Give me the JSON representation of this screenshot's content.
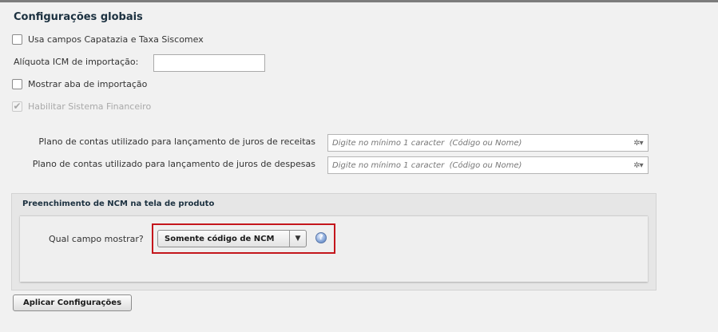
{
  "page": {
    "title": "Configurações globais"
  },
  "options": {
    "capatazia": {
      "label": "Usa campos Capatazia e Taxa Siscomex",
      "checked": false
    },
    "aliquota": {
      "label": "Alíquota ICM de importação:",
      "value": ""
    },
    "mostrar_aba": {
      "label": "Mostrar aba de importação",
      "checked": false
    },
    "financeiro": {
      "label": "Habilitar Sistema Financeiro",
      "checked": true,
      "disabled": true,
      "check_glyph": "✔"
    }
  },
  "plano_contas": {
    "receitas": {
      "label": "Plano de contas utilizado para lançamento de juros de receitas",
      "placeholder": "Digite no mínimo 1 caracter  (Código ou Nome)"
    },
    "despesas": {
      "label": "Plano de contas utilizado para lançamento de juros de despesas",
      "placeholder": "Digite no mínimo 1 caracter  (Código ou Nome)"
    },
    "gear_glyph": "✲▾"
  },
  "ncm_panel": {
    "title": "Preenchimento de NCM na tela de produto",
    "question_label": "Qual campo mostrar?",
    "selected_value": "Somente código de NCM",
    "arrow_glyph": "▼",
    "help_glyph": "?"
  },
  "actions": {
    "apply_label": "Aplicar Configurações"
  },
  "colors": {
    "highlight_border": "#c4161c",
    "title_color": "#1c3140"
  }
}
